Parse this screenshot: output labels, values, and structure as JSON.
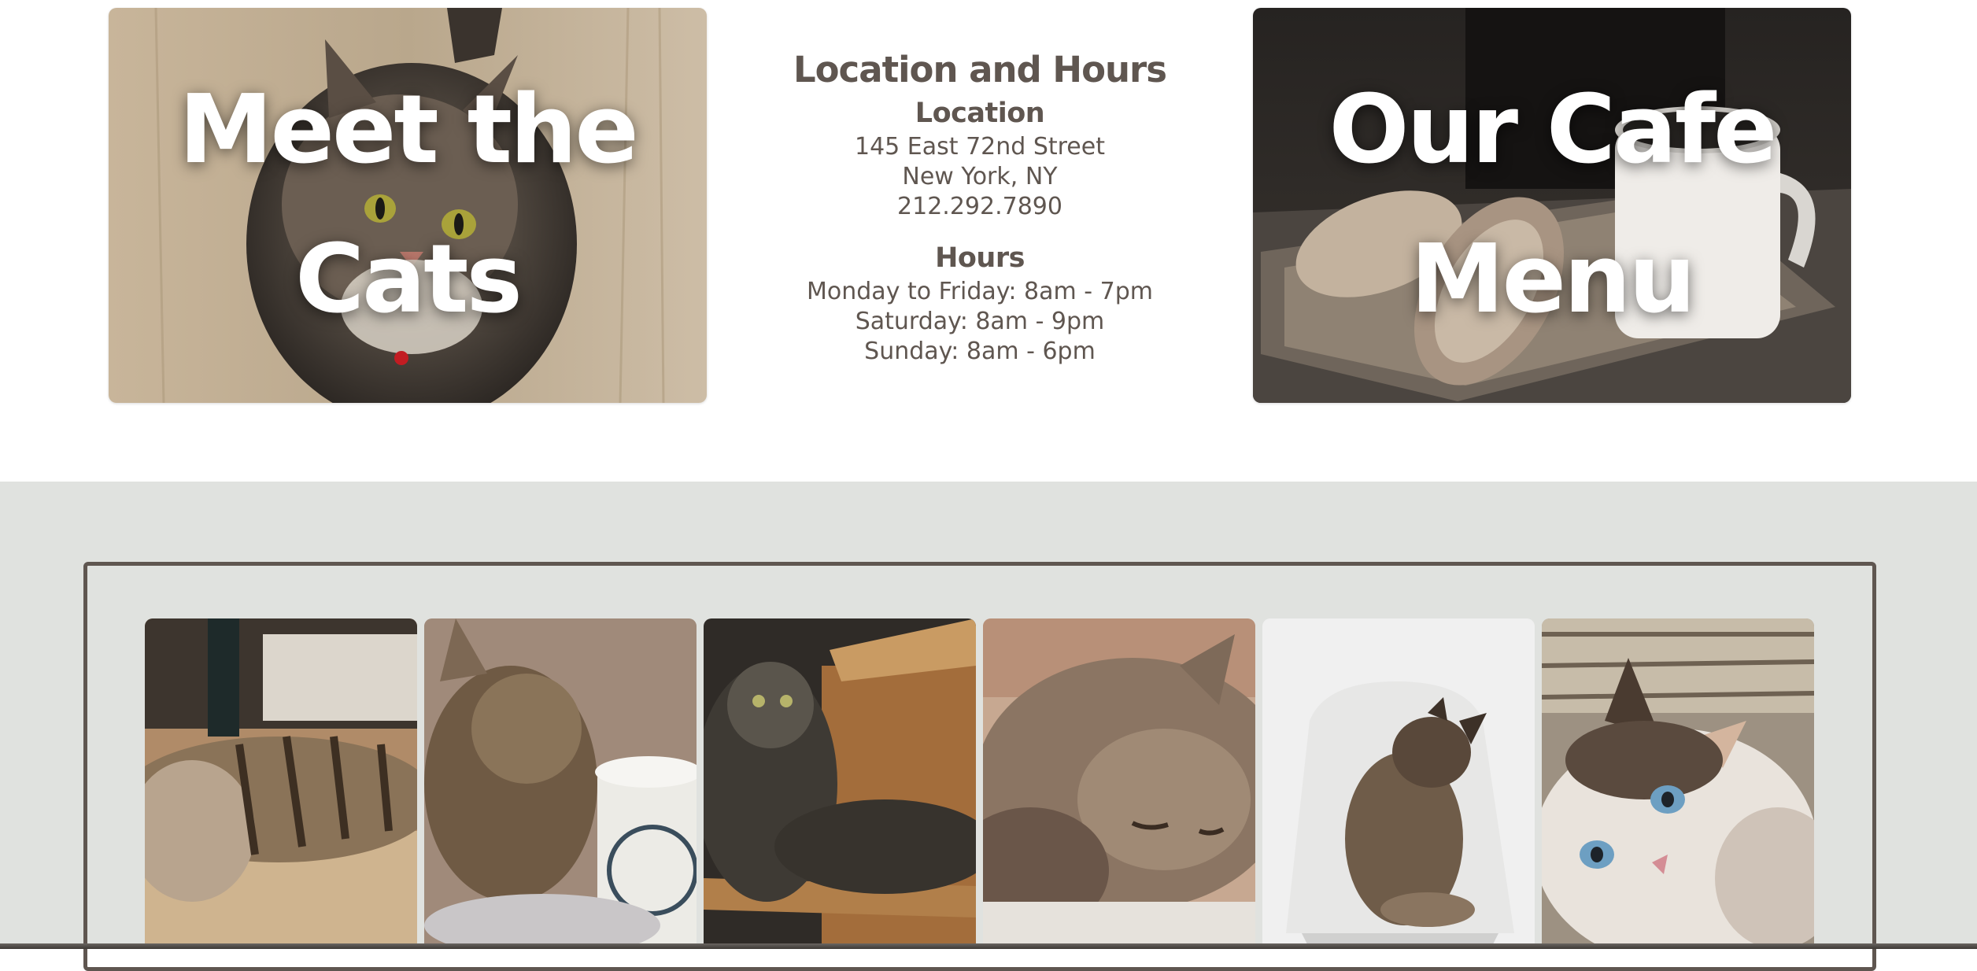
{
  "promos": {
    "cats": {
      "title": "Meet the Cats",
      "image": "tabby-cat-looking-up-photo"
    },
    "menu": {
      "title": "Our Cafe Menu",
      "image": "croissants-and-mug-photo"
    }
  },
  "info": {
    "heading": "Location and Hours",
    "location": {
      "heading": "Location",
      "street": "145 East 72nd Street",
      "city": "New York, NY",
      "phone": "212.292.7890"
    },
    "hours": {
      "heading": "Hours",
      "weekday": "Monday to Friday: 8am - 7pm",
      "saturday": "Saturday: 8am - 9pm",
      "sunday": "Sunday: 8am - 6pm"
    }
  },
  "gallery": {
    "photos": [
      "tabby-cat-lying-photo",
      "cat-with-coffee-cup-photo",
      "cat-on-chair-photo",
      "sleeping-cat-photo",
      "kitten-on-white-chair-photo",
      "calico-cat-blue-eyes-photo"
    ]
  },
  "colors": {
    "text": "#5f5650",
    "gallery_background": "#e0e2df",
    "frame_border": "#5f5650"
  }
}
